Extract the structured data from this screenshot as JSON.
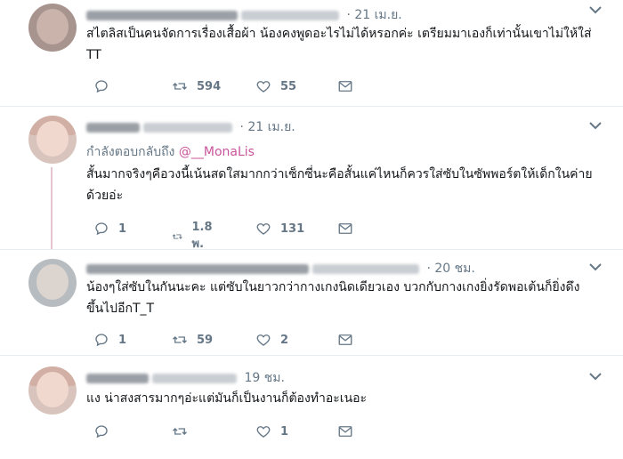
{
  "tweets": [
    {
      "date": "· 21 เม.ย.",
      "text": "สไตลิสเป็นคนจัดการเรื่องเสื้อผ้า น้องคงพูดอะไรไม่ได้หรอกค่ะ เตรียมมาเองก็เท่านั้นเขาไม่ให้ใส่ TT",
      "retweets": "594",
      "likes": "55",
      "replies": ""
    },
    {
      "date": "· 21 เม.ย.",
      "reply_prefix": "กำลังตอบกลับถึง",
      "reply_handle": "@__MonaLis",
      "text": "สั้นมากจริงๆคือวงนี้เน้นสดใสมากกว่าเซ็กซี่นะคือสั้นแค่ไหนก็ควรใส่ซับในซัพพอร์ตให้เด็กในค่ายด้วยอ่ะ",
      "replies": "1",
      "retweets": "1.8 พ.",
      "likes": "131"
    },
    {
      "date": "· 20 ชม.",
      "text": "น้องๆใส่ซับในกันนะคะ แต่ซับในยาวกว่ากางเกงนิดเดียวเอง บวกกับกางเกงยิ่งรัดพอเต้นก็ยิ่งดึงขึ้นไปอีกT_T",
      "replies": "1",
      "retweets": "59",
      "likes": "2"
    },
    {
      "date": "19 ชม.",
      "text": "แง น่าสงสารมากๆอ่ะแต่มันก็เป็นงานก็ต้องทำอะเนอะ",
      "replies": "",
      "retweets": "",
      "likes": "1"
    }
  ]
}
